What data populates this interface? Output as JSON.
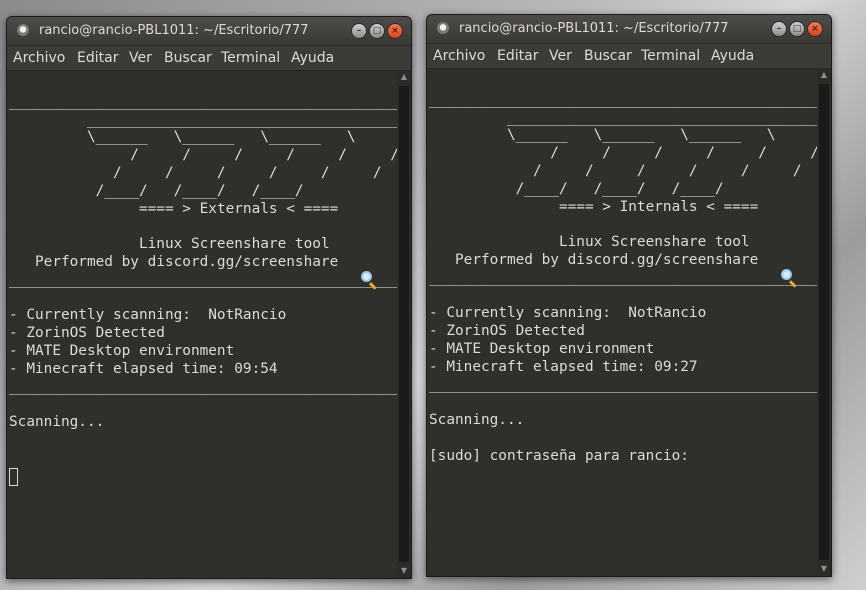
{
  "window_left": {
    "title": "rancio@rancio-PBL1011: ~/Escritorio/777",
    "menu": [
      "Archivo",
      "Editar",
      "Ver",
      "Buscar",
      "Terminal",
      "Ayuda"
    ],
    "terminal_text": "\n______________________________________________________________\n         _____________________________________\n         \\______   \\______   \\______   \\\n              /     /     /     /     /     /\n            /     /     /     /     /     /\n          /____/   /____/   /____/\n               ==== > Externals < ====\n\n               Linux Screenshare tool\n   Performed by discord.gg/screenshare\n______________________________________________________________\n\n- Currently scanning:  NotRancio\n- ZorinOS Detected\n- MATE Desktop environment\n- Minecraft elapsed time: 09:54\n______________________________________________________________\n\nScanning...\n"
  },
  "window_right": {
    "title": "rancio@rancio-PBL1011: ~/Escritorio/777",
    "menu": [
      "Archivo",
      "Editar",
      "Ver",
      "Buscar",
      "Terminal",
      "Ayuda"
    ],
    "terminal_text": "\n______________________________________________________________\n         _____________________________________\n         \\______   \\______   \\______   \\\n              /     /     /     /     /     /\n            /     /     /     /     /     /\n          /____/   /____/   /____/\n               ==== > Internals < ====\n\n               Linux Screenshare tool\n   Performed by discord.gg/screenshare\n______________________________________________________________\n\n- Currently scanning:  NotRancio\n- ZorinOS Detected\n- MATE Desktop environment\n- Minecraft elapsed time: 09:27\n______________________________________________________________\n\nScanning...\n\n[sudo] contraseña para rancio:"
  },
  "icons": {
    "window_icon": "terminal-icon",
    "buttons": [
      "minimize-icon",
      "maximize-icon",
      "close-icon"
    ],
    "magnifier": "magnifying-glass-icon"
  }
}
